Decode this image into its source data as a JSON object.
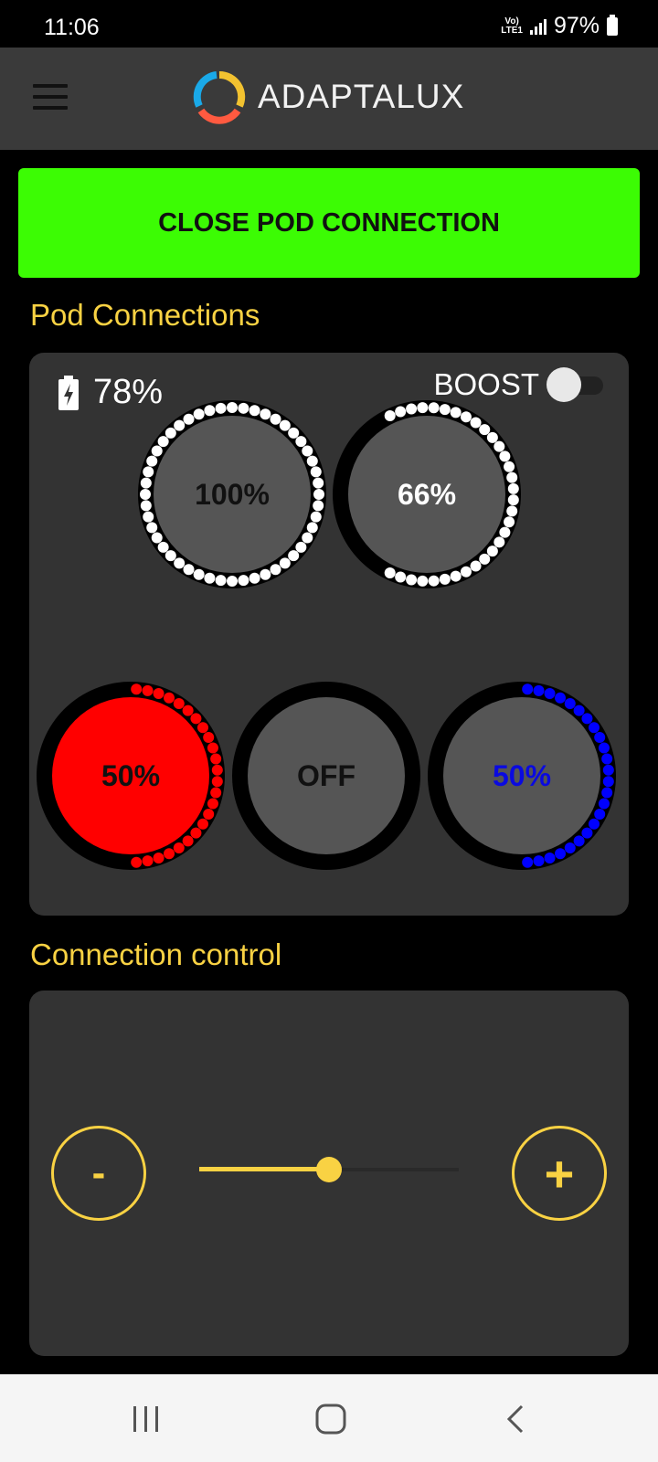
{
  "status_bar": {
    "time": "11:06",
    "network_top": "Vo)",
    "network_bottom": "LTE1",
    "battery": "97%"
  },
  "app_bar": {
    "logo_text": "ADAPTALUX",
    "menu_icon": "hamburger-menu-icon"
  },
  "close_button": {
    "label": "CLOSE POD CONNECTION"
  },
  "pod_connections": {
    "title": "Pod Connections",
    "battery": "78%",
    "boost_label": "BOOST",
    "boost_on": false,
    "dials": [
      {
        "label": "100%",
        "level": 1.0,
        "color": "#ffffff",
        "text_color": "#111111",
        "fill": "#555555"
      },
      {
        "label": "66%",
        "level": 0.66,
        "color": "#ffffff",
        "text_color": "#ffffff",
        "fill": "#555555"
      },
      {
        "label": "50%",
        "level": 0.5,
        "color": "#ff0000",
        "text_color": "#111111",
        "fill": "#ff0000"
      },
      {
        "label": "OFF",
        "level": 0.0,
        "color": "#ffffff",
        "text_color": "#111111",
        "fill": "#555555"
      },
      {
        "label": "50%",
        "level": 0.5,
        "color": "#0000ff",
        "text_color": "#0a0ae0",
        "fill": "#555555"
      }
    ]
  },
  "connection_control": {
    "title": "Connection control",
    "minus_label": "-",
    "plus_label": "+",
    "slider_level": 0.5
  },
  "colors": {
    "accent_yellow": "#f9d243",
    "button_green": "#3cfc04",
    "card": "#333333"
  }
}
